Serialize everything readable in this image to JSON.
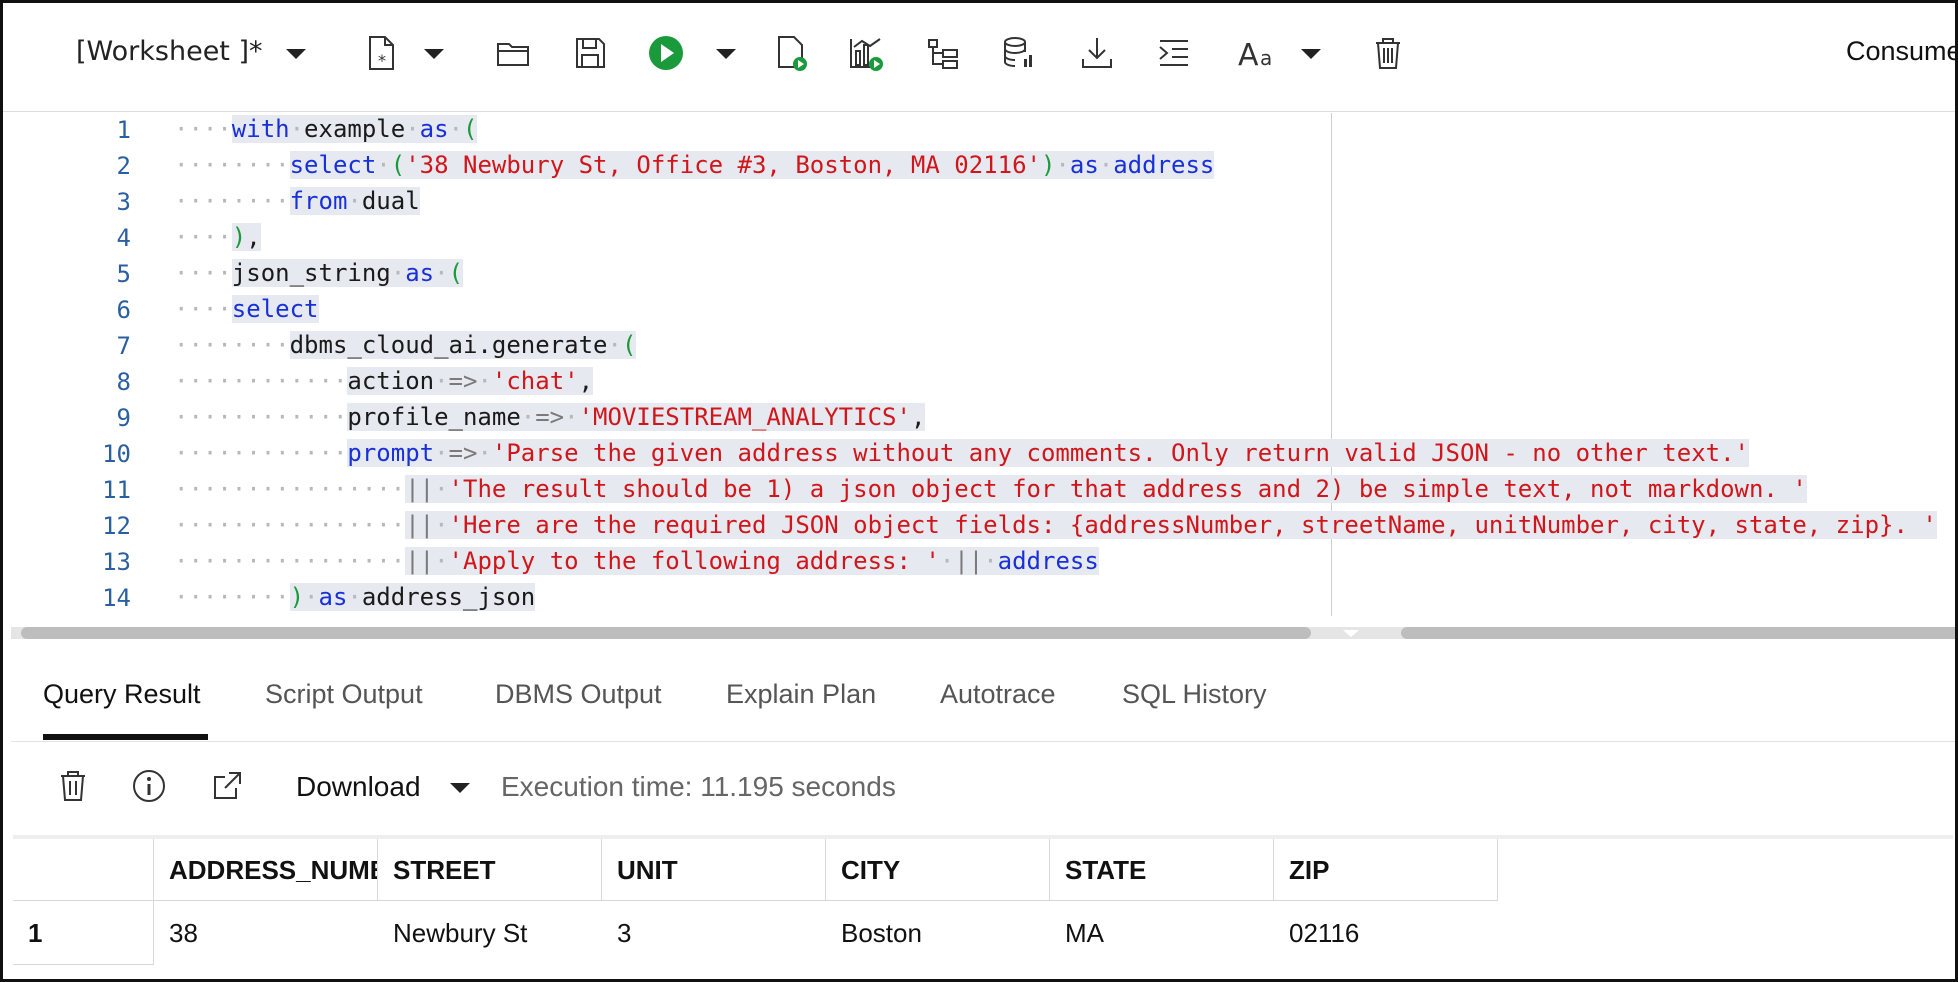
{
  "toolbar": {
    "worksheet_title": "[Worksheet ]*",
    "icons": [
      "new-file-icon",
      "open-folder-icon",
      "save-icon",
      "run-icon",
      "run-script-icon",
      "run-chart-icon",
      "explain-tree-icon",
      "database-icon",
      "download-icon",
      "format-indent-icon",
      "font-size-icon",
      "trash-icon"
    ],
    "connection_label": "Consumer",
    "run_color": "#1a9a3a"
  },
  "editor": {
    "line_numbers": [
      "1",
      "2",
      "3",
      "4",
      "5",
      "6",
      "7",
      "8",
      "9",
      "10",
      "11",
      "12",
      "13",
      "14"
    ],
    "lines": [
      "with example as (",
      "    select ('38 Newbury St, Office #3, Boston, MA 02116') as address",
      "    from dual",
      "),",
      "json_string as (",
      "select",
      "    dbms_cloud_ai.generate (",
      "        action => 'chat',",
      "        profile_name => 'MOVIESTREAM_ANALYTICS',",
      "        prompt => 'Parse the given address without any comments. Only return valid JSON - no other text.'",
      "            || 'The result should be 1) a json object for that address and 2) be simple text, not markdown. '",
      "            || 'Here are the required JSON object fields: {addressNumber, streetName, unitNumber, city, state, zip}. '",
      "            || 'Apply to the following address: ' || address",
      "    ) as address_json"
    ]
  },
  "tabs": [
    "Query Result",
    "Script Output",
    "DBMS Output",
    "Explain Plan",
    "Autotrace",
    "SQL History"
  ],
  "result_toolbar": {
    "download_label": "Download",
    "execution_time": "Execution time: 11.195 seconds"
  },
  "grid": {
    "headers": [
      "",
      "ADDRESS_NUMBER",
      "STREET",
      "UNIT",
      "CITY",
      "STATE",
      "ZIP"
    ],
    "rows": [
      [
        "1",
        "38",
        "Newbury St",
        "3",
        "Boston",
        "MA",
        "02116"
      ]
    ]
  }
}
